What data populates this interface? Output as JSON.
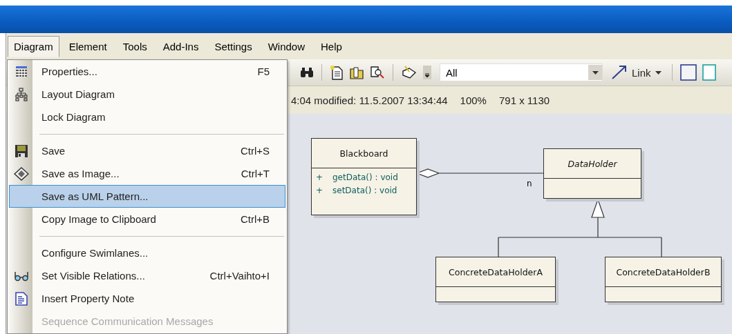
{
  "menubar": [
    {
      "label": "Diagram",
      "selected": true
    },
    {
      "label": "Element",
      "selected": false
    },
    {
      "label": "Tools",
      "selected": false
    },
    {
      "label": "Add-Ins",
      "selected": false
    },
    {
      "label": "Settings",
      "selected": false
    },
    {
      "label": "Window",
      "selected": false
    },
    {
      "label": "Help",
      "selected": false
    }
  ],
  "menu": {
    "items": [
      {
        "kind": "item",
        "label": "Properties...",
        "shortcut": "F5",
        "selected": false,
        "disabled": false
      },
      {
        "kind": "item",
        "label": "Layout Diagram",
        "selected": false,
        "disabled": false
      },
      {
        "kind": "item",
        "label": "Lock Diagram",
        "selected": false,
        "disabled": false
      },
      {
        "kind": "separator"
      },
      {
        "kind": "item",
        "label": "Save",
        "shortcut": "Ctrl+S",
        "selected": false,
        "disabled": false
      },
      {
        "kind": "item",
        "label": "Save as Image...",
        "shortcut": "Ctrl+T",
        "selected": false,
        "disabled": false
      },
      {
        "kind": "item",
        "label": "Save as UML Pattern...",
        "selected": true,
        "disabled": false
      },
      {
        "kind": "item",
        "label": "Copy Image to Clipboard",
        "shortcut": "Ctrl+B",
        "selected": false,
        "disabled": false
      },
      {
        "kind": "separator"
      },
      {
        "kind": "item",
        "label": "Configure Swimlanes...",
        "selected": false,
        "disabled": false
      },
      {
        "kind": "item",
        "label": "Set Visible Relations...",
        "shortcut": "Ctrl+Vaihto+I",
        "selected": false,
        "disabled": false
      },
      {
        "kind": "item",
        "label": "Insert Property Note",
        "selected": false,
        "disabled": false
      },
      {
        "kind": "item",
        "label": "Sequence Communication Messages",
        "selected": false,
        "disabled": true
      }
    ]
  },
  "toolbar": {
    "filter": {
      "value": "All"
    },
    "link_button": {
      "label": "Link"
    }
  },
  "info_bar": [
    "4:04 modified: 11.5.2007 13:34:44",
    "100%",
    "791 x 1130"
  ],
  "diagram": {
    "classes": [
      {
        "name": "Blackboard",
        "abstract": false,
        "operations": [
          {
            "visibility": "+",
            "signature": "getData() : void"
          },
          {
            "visibility": "+",
            "signature": "setData() : void"
          }
        ]
      },
      {
        "name": "DataHolder",
        "abstract": true
      },
      {
        "name": "ConcreteDataHolderA",
        "abstract": false
      },
      {
        "name": "ConcreteDataHolderB",
        "abstract": false
      }
    ],
    "multiplicity": "n"
  }
}
